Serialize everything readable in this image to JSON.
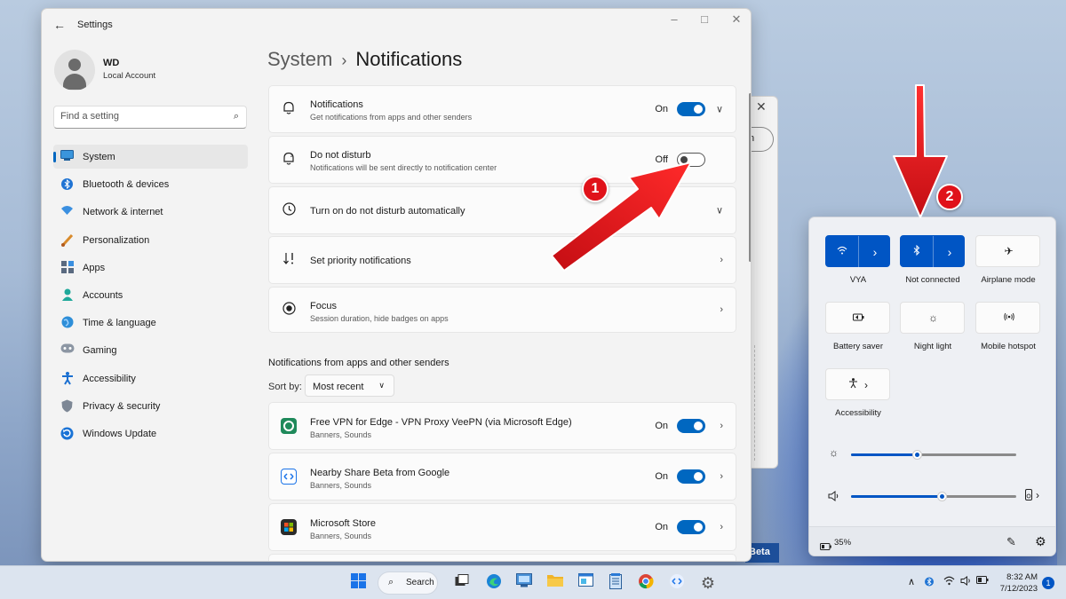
{
  "window": {
    "title": "Settings",
    "back_icon": "back-arrow-icon",
    "minimize": "–",
    "maximize": "□",
    "close": "✕"
  },
  "profile": {
    "name": "WD",
    "account": "Local Account"
  },
  "search": {
    "placeholder": "Find a setting"
  },
  "nav": [
    {
      "label": "System",
      "icon": "system-icon",
      "active": true
    },
    {
      "label": "Bluetooth & devices",
      "icon": "bluetooth-icon"
    },
    {
      "label": "Network & internet",
      "icon": "network-icon"
    },
    {
      "label": "Personalization",
      "icon": "brush-icon"
    },
    {
      "label": "Apps",
      "icon": "apps-icon"
    },
    {
      "label": "Accounts",
      "icon": "accounts-icon"
    },
    {
      "label": "Time & language",
      "icon": "globe-icon"
    },
    {
      "label": "Gaming",
      "icon": "gamepad-icon"
    },
    {
      "label": "Accessibility",
      "icon": "accessibility-icon"
    },
    {
      "label": "Privacy & security",
      "icon": "shield-icon"
    },
    {
      "label": "Windows Update",
      "icon": "update-icon"
    }
  ],
  "breadcrumb": {
    "parent": "System",
    "separator": "›",
    "current": "Notifications"
  },
  "settings": {
    "notifications": {
      "title": "Notifications",
      "subtitle": "Get notifications from apps and other senders",
      "state": "On"
    },
    "dnd": {
      "title": "Do not disturb",
      "subtitle": "Notifications will be sent directly to notification center",
      "state": "Off"
    },
    "auto_dnd": {
      "title": "Turn on do not disturb automatically"
    },
    "priority": {
      "title": "Set priority notifications"
    },
    "focus": {
      "title": "Focus",
      "subtitle": "Session duration, hide badges on apps"
    }
  },
  "apps_section": {
    "heading": "Notifications from apps and other senders",
    "sort_label": "Sort by:",
    "sort_value": "Most recent",
    "apps": [
      {
        "name": "Free VPN for Edge - VPN Proxy VeePN (via Microsoft Edge)",
        "sub": "Banners, Sounds",
        "state": "On",
        "color": "#1f8a5b"
      },
      {
        "name": "Nearby Share Beta from Google",
        "sub": "Banners, Sounds",
        "state": "On",
        "color": "#1a73e8"
      },
      {
        "name": "Microsoft Store",
        "sub": "Banners, Sounds",
        "state": "On",
        "color": "#2b2b2b"
      }
    ]
  },
  "background_window": {
    "label": "Beta"
  },
  "annotations": {
    "badge1": "1",
    "badge2": "2"
  },
  "quick_settings": {
    "tiles": [
      {
        "label": "VYA",
        "icon": "wifi-icon",
        "on": true
      },
      {
        "label": "Not connected",
        "icon": "bluetooth-icon",
        "on": true
      },
      {
        "label": "Airplane mode",
        "icon": "airplane-icon",
        "on": false
      },
      {
        "label": "Battery saver",
        "icon": "battery-saver-icon",
        "on": false
      },
      {
        "label": "Night light",
        "icon": "night-light-icon",
        "on": false
      },
      {
        "label": "Mobile hotspot",
        "icon": "hotspot-icon",
        "on": false
      },
      {
        "label": "Accessibility",
        "icon": "accessibility-icon",
        "on": false
      }
    ],
    "brightness": 0.4,
    "volume": 0.55,
    "battery": "35%"
  },
  "taskbar": {
    "search_label": "Search",
    "time": "8:32 AM",
    "date": "7/12/2023",
    "notification_count": "1"
  },
  "colors": {
    "accent": "#0067c0",
    "qs_accent": "#0055c4",
    "annotation_red": "#e0121a"
  }
}
